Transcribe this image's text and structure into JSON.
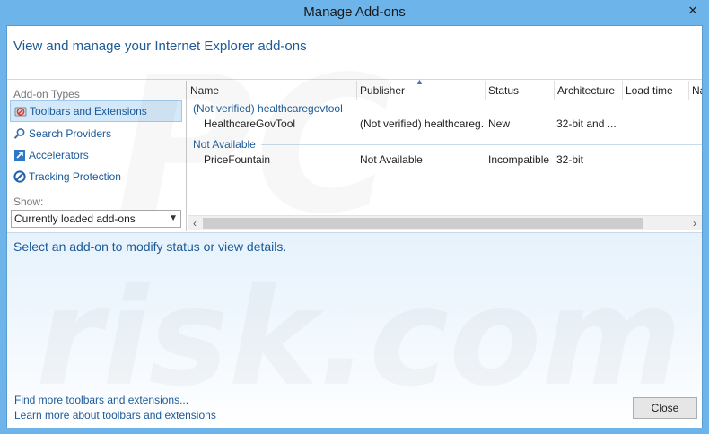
{
  "window": {
    "title": "Manage Add-ons",
    "close_glyph": "✕"
  },
  "header": {
    "title": "View and manage your Internet Explorer add-ons"
  },
  "sidebar": {
    "types_label": "Add-on Types",
    "items": [
      {
        "label": "Toolbars and Extensions",
        "icon": "toolbar-icon",
        "selected": true
      },
      {
        "label": "Search Providers",
        "icon": "search-icon",
        "selected": false
      },
      {
        "label": "Accelerators",
        "icon": "accelerator-icon",
        "selected": false
      },
      {
        "label": "Tracking Protection",
        "icon": "tracking-protection-icon",
        "selected": false
      }
    ],
    "show_label": "Show:",
    "show_value": "Currently loaded add-ons"
  },
  "list": {
    "columns": [
      "Name",
      "Publisher",
      "Status",
      "Architecture",
      "Load time",
      "Na"
    ],
    "groups": [
      {
        "label": "(Not verified) healthcaregovtool",
        "rows": [
          {
            "name": "HealthcareGovTool",
            "publisher": "(Not verified) healthcareg...",
            "status": "New",
            "architecture": "32-bit and ..."
          }
        ]
      },
      {
        "label": "Not Available",
        "rows": [
          {
            "name": "PriceFountain",
            "publisher": "Not Available",
            "status": "Incompatible",
            "architecture": "32-bit"
          }
        ]
      }
    ]
  },
  "details": {
    "message": "Select an add-on to modify status or view details.",
    "link_more": "Find more toolbars and extensions...",
    "link_learn": "Learn more about toolbars and extensions",
    "close_label": "Close"
  },
  "watermark": {
    "line1": "PC",
    "line2": "risk.com"
  },
  "colors": {
    "accent": "#1c5a99",
    "frame": "#6cb4ea",
    "selection": "#d3e8f8"
  }
}
